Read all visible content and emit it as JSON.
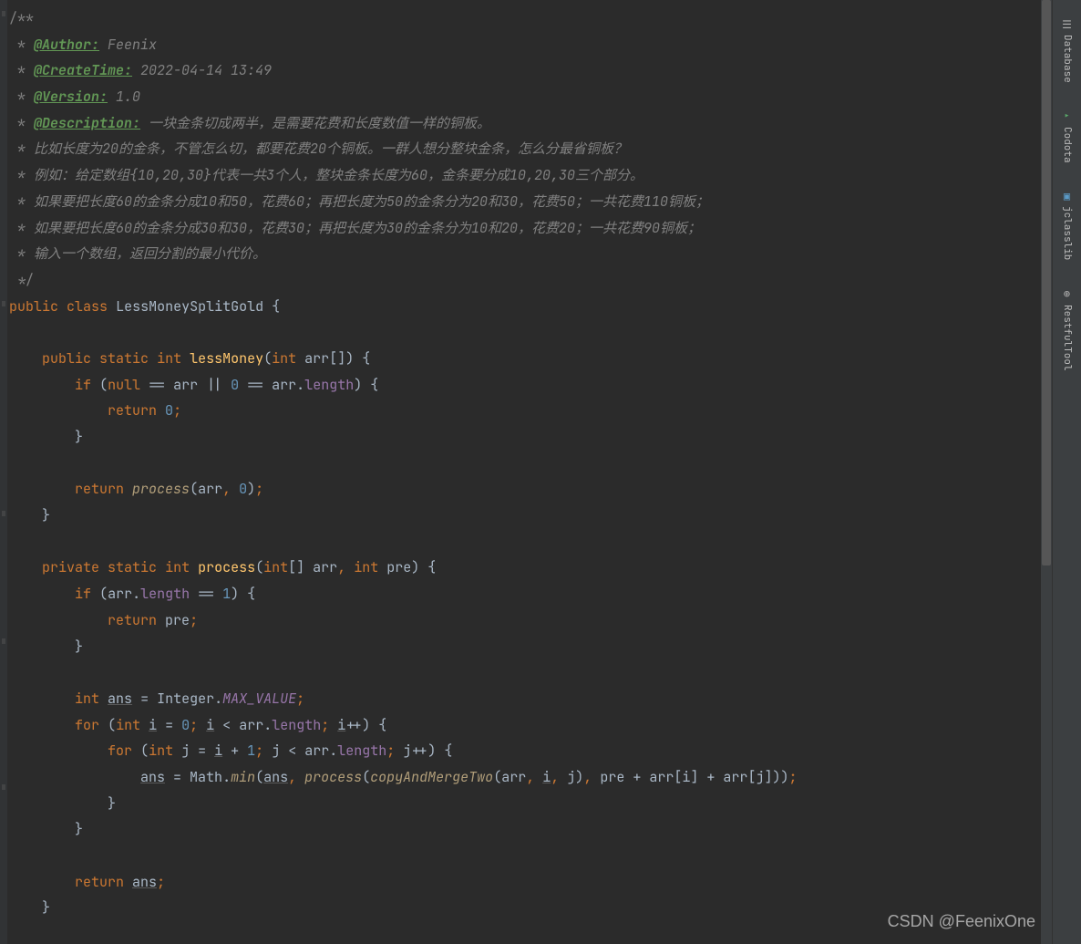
{
  "doc": {
    "open": "/**",
    "author_tag": "@Author:",
    "author_val": " Feenix",
    "create_tag": "@CreateTime:",
    "create_val": " 2022-04-14 13:49",
    "version_tag": "@Version:",
    "version_val": " 1.0",
    "desc_tag": "@Description:",
    "desc_val": " 一块金条切成两半，是需要花费和长度数值一样的铜板。",
    "line6": " * 比如长度为20的金条，不管怎么切，都要花费20个铜板。一群人想分整块金条，怎么分最省铜板？",
    "line7": " * 例如：给定数组{10,20,30}代表一共3个人，整块金条长度为60，金条要分成10,20,30三个部分。",
    "line8": " * 如果要把长度60的金条分成10和50，花费60；再把长度为50的金条分为20和30，花费50；一共花费110铜板；",
    "line9": " * 如果要把长度60的金条分成30和30，花费30；再把长度为30的金条分为10和20，花费20；一共花费90铜板；",
    "line10": " * 输入一个数组，返回分割的最小代价。",
    "close": " */"
  },
  "code": {
    "kw_public": "public",
    "kw_class": "class",
    "class_name": "LessMoneySplitGold",
    "kw_static": "static",
    "kw_int": "int",
    "method_lessMoney": "lessMoney",
    "param_arr": "arr",
    "kw_if": "if",
    "kw_null": "null",
    "field_length": "length",
    "kw_return": "return",
    "num_0": "0",
    "method_process": "process",
    "kw_private": "private",
    "param_pre": "pre",
    "num_1": "1",
    "var_ans": "ans",
    "class_Integer": "Integer",
    "const_MAX_VALUE": "MAX_VALUE",
    "kw_for": "for",
    "var_i": "i",
    "var_j": "j",
    "class_Math": "Math",
    "method_min": "min",
    "method_copyAndMergeTwo": "copyAndMergeTwo"
  },
  "sidebar": {
    "db": "Database",
    "codota": "Codota",
    "jclass": "jclasslib",
    "rest": "RestfulTool"
  },
  "watermark": "CSDN @FeenixOne"
}
